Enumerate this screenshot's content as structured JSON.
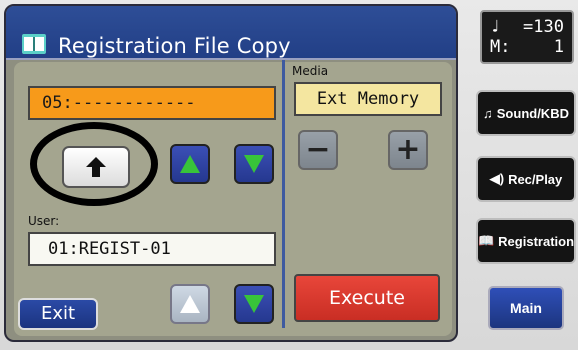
{
  "window": {
    "title": "Registration File Copy",
    "icon": "book-icon"
  },
  "source": {
    "selected_value": "05:------------"
  },
  "media": {
    "label": "Media",
    "value": "Ext Memory",
    "minus_label": "−",
    "plus_label": "+"
  },
  "user": {
    "label": "User:",
    "value": "01:REGIST-01"
  },
  "buttons": {
    "exit_label": "Exit",
    "execute_label": "Execute"
  },
  "status": {
    "tempo_glyph": "♩",
    "tempo_value": "=130",
    "measure_label": "M:",
    "measure_value": "1"
  },
  "sidebar": {
    "items": [
      {
        "label": "Sound/KBD",
        "icon": "music-note-icon"
      },
      {
        "label": "Rec/Play",
        "icon": "speaker-icon"
      },
      {
        "label": "Registration",
        "icon": "book-icon"
      }
    ],
    "main_label": "Main"
  },
  "colors": {
    "title_bar": "#2e4e97",
    "selected_field": "#f79a1a",
    "media_field": "#f4e6a0",
    "execute": "#e8463a",
    "arrow_green": "#38c43a"
  }
}
